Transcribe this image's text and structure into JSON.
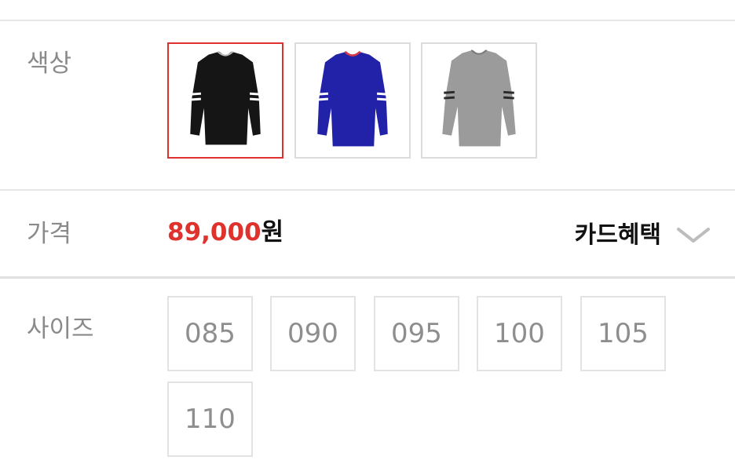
{
  "color_section": {
    "label": "색상",
    "options": [
      {
        "name": "black",
        "body": "#151515",
        "stripe": "#ffffff",
        "collar": "#111111",
        "selected": true
      },
      {
        "name": "blue",
        "body": "#2222a8",
        "stripe": "#ffffff",
        "collar": "#d33a48",
        "selected": false
      },
      {
        "name": "gray",
        "body": "#9b9b9b",
        "stripe": "#2a2a2a",
        "collar": "#8a8a8a",
        "selected": false
      }
    ]
  },
  "price_section": {
    "label": "가격",
    "amount": "89,000",
    "currency": "원",
    "card_benefit_label": "카드혜택"
  },
  "size_section": {
    "label": "사이즈",
    "sizes": [
      "085",
      "090",
      "095",
      "100",
      "105",
      "110"
    ]
  },
  "colors": {
    "accent": "#e0322c",
    "label_text": "#8a8a8a",
    "border": "#e3e3e3"
  }
}
